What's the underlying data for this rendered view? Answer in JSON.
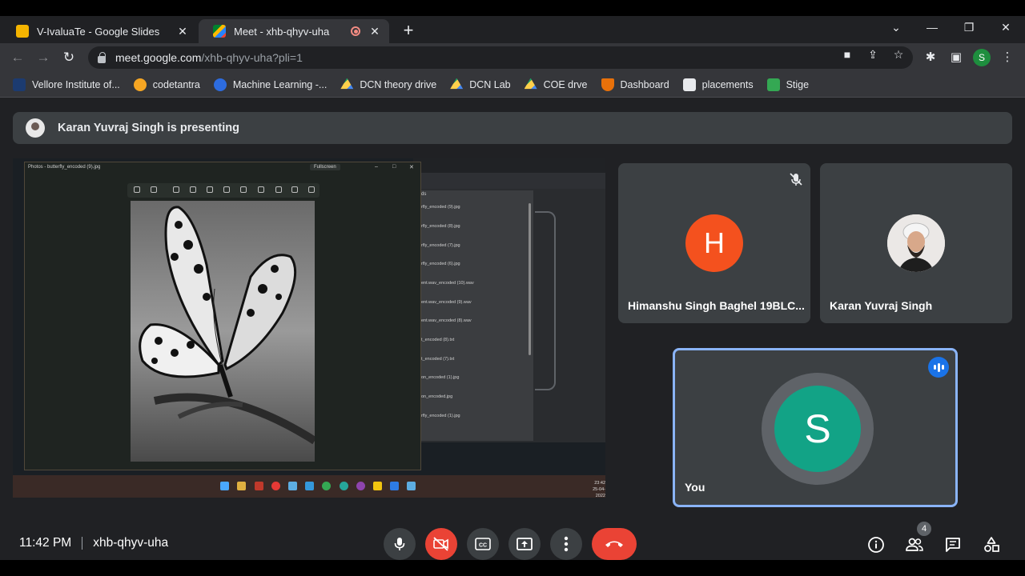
{
  "browser": {
    "tabs": [
      {
        "title": "V-IvaluaTe - Google Slides",
        "favicon": "slides-icon",
        "active": false
      },
      {
        "title": "Meet - xhb-qhyv-uha",
        "favicon": "meet-icon",
        "active": true,
        "recording": true
      }
    ],
    "address": {
      "host": "meet.google.com",
      "path": "/xhb-qhyv-uha?pli=1"
    },
    "profile_initial": "S",
    "bookmarks": [
      {
        "label": "Vellore Institute of...",
        "icon": "vit-icon"
      },
      {
        "label": "codetantra",
        "icon": "codetantra-icon"
      },
      {
        "label": "Machine Learning -...",
        "icon": "c-icon"
      },
      {
        "label": "DCN theory drive",
        "icon": "drive-icon"
      },
      {
        "label": "DCN Lab",
        "icon": "drive-icon"
      },
      {
        "label": "COE drve",
        "icon": "drive-icon"
      },
      {
        "label": "Dashboard",
        "icon": "dashboard-icon"
      },
      {
        "label": "placements",
        "icon": "page-icon"
      },
      {
        "label": "Stige",
        "icon": "stige-icon"
      }
    ]
  },
  "meet": {
    "presenting_banner": "Karan Yuvraj Singh is presenting",
    "shared_screen": {
      "photos_title": "Photos - butterfly_encoded (9).jpg",
      "fullscreen_label": "Fullscreen",
      "folder_header": "ds",
      "files": [
        "rfly_encoded (9).jpg",
        "rfly_encoded (8).jpg",
        "rfly_encoded (7).jpg",
        "rfly_encoded (6).jpg",
        "ent.wav_encoded (10).wav",
        "ent.wav_encoded (9).wav",
        "ent.wav_encoded (8).wav",
        "t_encoded (8).txt",
        "t_encoded (7).txt",
        "on_encoded (1).jpg",
        "on_encoded.jpg",
        "rfly_encoded (1).jpg"
      ],
      "clock_time": "23:42",
      "clock_date": "25-04-2022"
    },
    "participants": [
      {
        "name": "Himanshu Singh Baghel 19BLC...",
        "initial": "H",
        "color": "#f4511e",
        "muted": true
      },
      {
        "name": "Karan Yuvraj Singh",
        "initial": "",
        "muted": false
      },
      {
        "name": "You",
        "initial": "S",
        "color": "#12a386",
        "speaking": true
      }
    ],
    "footer": {
      "time": "11:42 PM",
      "meeting_code": "xhb-qhyv-uha",
      "participant_count": "4"
    }
  }
}
